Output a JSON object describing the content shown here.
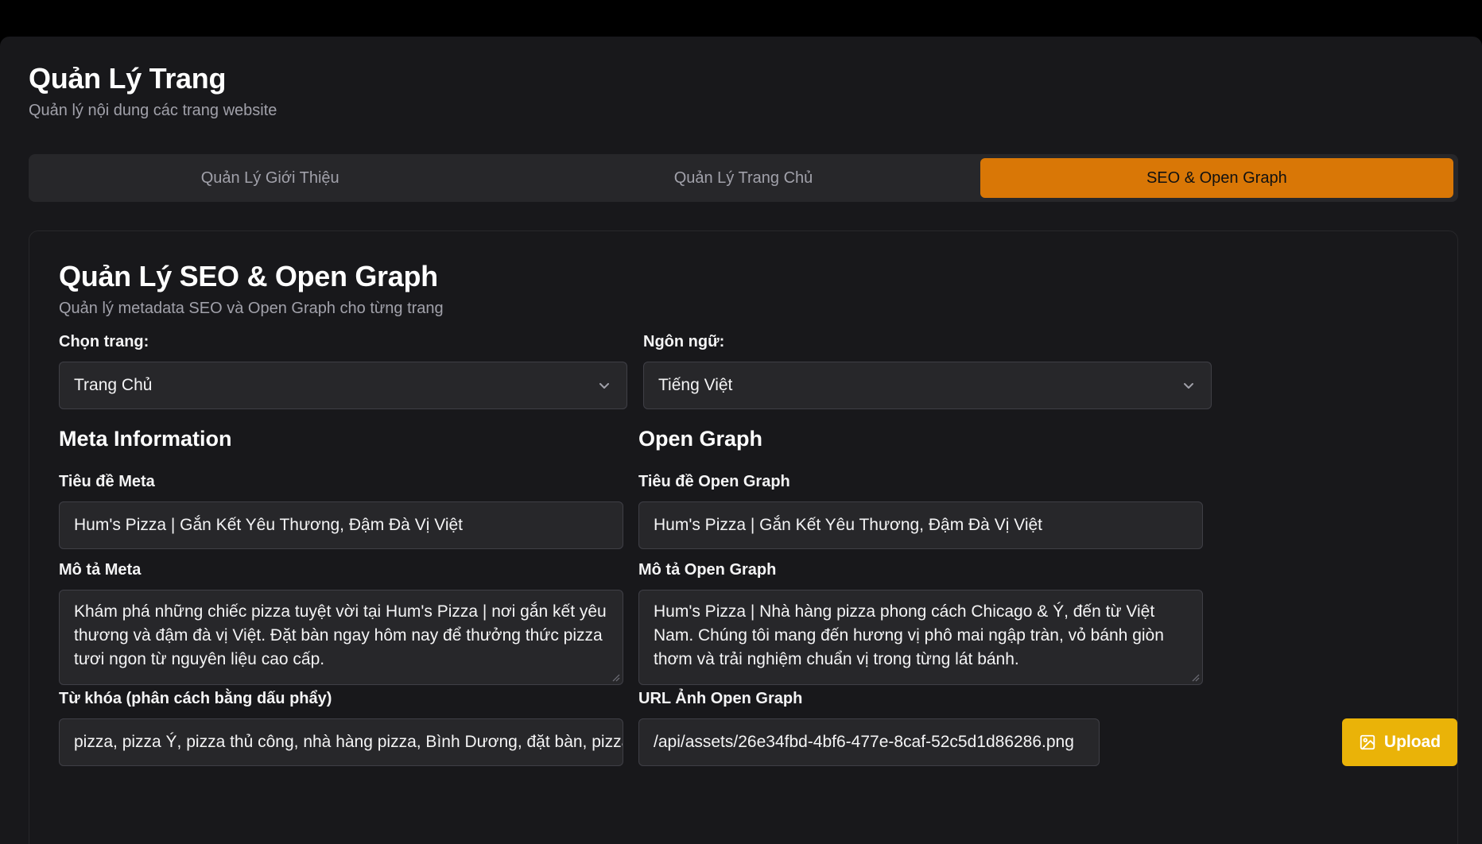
{
  "header": {
    "title": "Quản Lý Trang",
    "subtitle": "Quản lý nội dung các trang website"
  },
  "tabs": [
    {
      "label": "Quản Lý Giới Thiệu",
      "active": false
    },
    {
      "label": "Quản Lý Trang Chủ",
      "active": false
    },
    {
      "label": "SEO & Open Graph",
      "active": true
    }
  ],
  "card": {
    "title": "Quản Lý SEO & Open Graph",
    "subtitle": "Quản lý metadata SEO và Open Graph cho từng trang"
  },
  "page_select": {
    "label": "Chọn trang:",
    "value": "Trang Chủ",
    "icon": "chevron-down-icon"
  },
  "language_select": {
    "label": "Ngôn ngữ:",
    "value": "Tiếng Việt",
    "icon": "chevron-down-icon"
  },
  "meta": {
    "section_title": "Meta Information",
    "title_label": "Tiêu đề Meta",
    "title_value": "Hum's Pizza | Gắn Kết Yêu Thương, Đậm Đà Vị Việt",
    "description_label": "Mô tả Meta",
    "description_value": "Khám phá những chiếc pizza tuyệt vời tại Hum's Pizza | nơi gắn kết yêu thương và đậm đà vị Việt. Đặt bàn ngay hôm nay để thưởng thức pizza tươi ngon từ nguyên liệu cao cấp.",
    "keywords_label": "Từ khóa (phân cách bằng dấu phẩy)",
    "keywords_value": "pizza, pizza Ý, pizza thủ công, nhà hàng pizza, Bình Dương, đặt bàn, pizza tươi"
  },
  "open_graph": {
    "section_title": "Open Graph",
    "title_label": "Tiêu đề Open Graph",
    "title_value": "Hum's Pizza | Gắn Kết Yêu Thương, Đậm Đà Vị Việt",
    "description_label": "Mô tả Open Graph",
    "description_value": "Hum's Pizza | Nhà hàng pizza phong cách Chicago & Ý, đến từ Việt Nam. Chúng tôi mang đến hương vị phô mai ngập tràn, vỏ bánh giòn thơm và trải nghiệm chuẩn vị trong từng lát bánh.",
    "image_label": "URL Ảnh Open Graph",
    "image_value": "/api/assets/26e34fbd-4bf6-477e-8caf-52c5d1d86286.png",
    "upload_label": "Upload",
    "upload_icon": "image-icon"
  },
  "colors": {
    "accent": "#d97706",
    "upload": "#eab308",
    "background": "#18181b",
    "field": "#27272a"
  }
}
